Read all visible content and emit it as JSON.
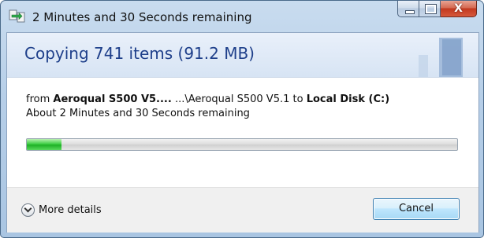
{
  "window": {
    "title": "2 Minutes and 30 Seconds remaining"
  },
  "caption_buttons": {
    "close_glyph": "X"
  },
  "header": {
    "title": "Copying 741 items (91.2 MB)"
  },
  "details": {
    "from_prefix": "from ",
    "source_name": "Aeroqual S500 V5....",
    "source_path": " ...\\Aeroqual S500 V5.1 to ",
    "destination": "Local Disk (C:)",
    "remaining": "About 2 Minutes and 30 Seconds remaining"
  },
  "progress": {
    "percent": 8,
    "color": "#2fc034"
  },
  "footer": {
    "more_details_label": "More details",
    "cancel_label": "Cancel"
  },
  "icons": {
    "title": "copy-icon",
    "more_details": "chevron-down-icon"
  }
}
